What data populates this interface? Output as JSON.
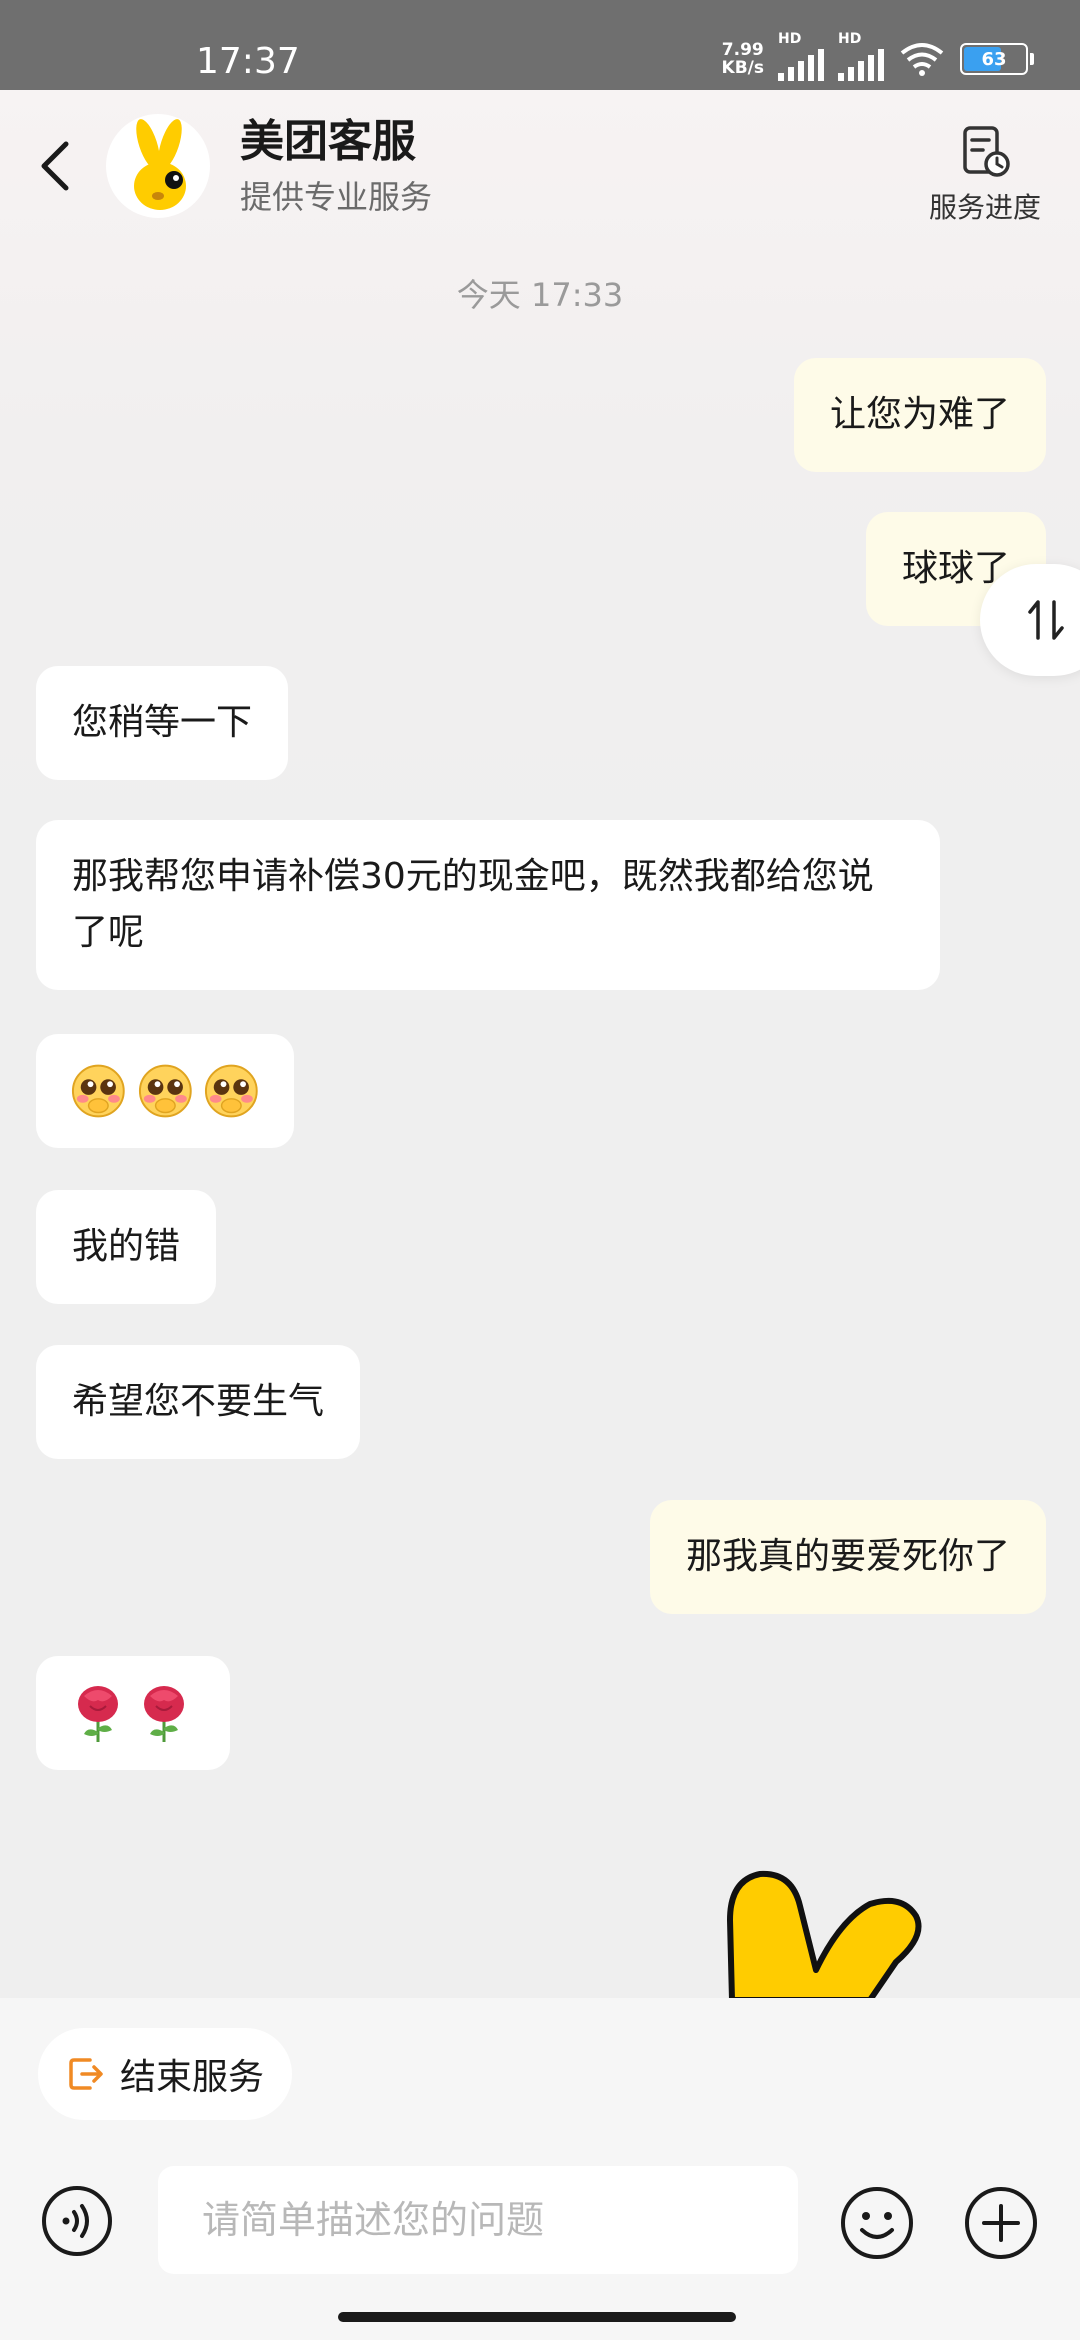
{
  "status_bar": {
    "time": "17:37",
    "net_speed_value": "7.99",
    "net_speed_unit": "KB/s",
    "sim1_tag": "HD",
    "sim2_tag": "HD",
    "battery_level": "63",
    "battery_fraction": 0.63,
    "battery_color": "#3aa0f0"
  },
  "header": {
    "title": "美团客服",
    "subtitle": "提供专业服务",
    "progress_label": "服务进度"
  },
  "chat": {
    "timestamp": "今天 17:33",
    "messages": [
      {
        "side": "me",
        "text": "让您为难了"
      },
      {
        "side": "me",
        "text": "球球了"
      },
      {
        "side": "them",
        "text": "您稍等一下"
      },
      {
        "side": "them",
        "text": "那我帮您申请补偿30元的现金吧，既然我都给您说了呢"
      },
      {
        "side": "them",
        "emoji": "pleading-face",
        "count": 3
      },
      {
        "side": "them",
        "text": "我的错"
      },
      {
        "side": "them",
        "text": "希望您不要生气"
      },
      {
        "side": "me",
        "text": "那我真的要爱死你了"
      },
      {
        "side": "them",
        "emoji": "rose",
        "count": 2
      }
    ]
  },
  "footer": {
    "end_service_label": "结束服务",
    "input_placeholder": "请简单描述您的问题"
  },
  "colors": {
    "my_bubble": "#fefbe8",
    "their_bubble": "#ffffff",
    "brand_yellow": "#ffcc00",
    "end_service_icon": "#f08a24"
  }
}
